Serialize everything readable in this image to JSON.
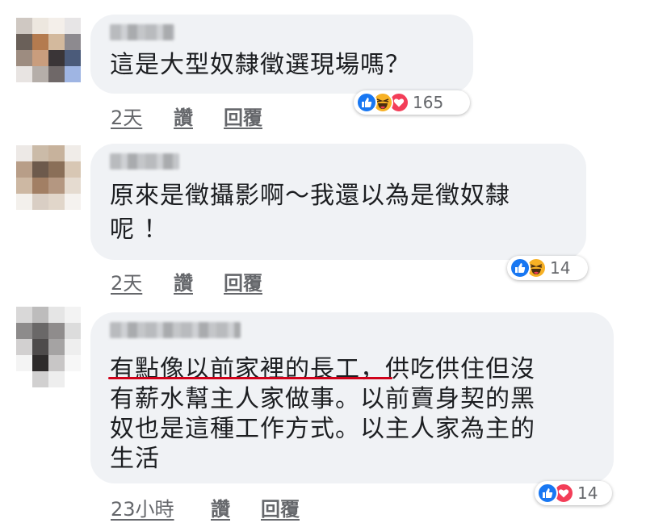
{
  "comments": [
    {
      "text_lines": [
        "這是大型奴隸徵選現場嗎？"
      ],
      "time": "2天",
      "like_label": "讚",
      "reply_label": "回覆",
      "reactions": [
        "like",
        "haha",
        "love"
      ],
      "reaction_count": "165"
    },
    {
      "text_lines": [
        "原來是徵攝影啊～我還以為是徵奴隸",
        "呢 ！"
      ],
      "time": "2天",
      "like_label": "讚",
      "reply_label": "回覆",
      "reactions": [
        "like",
        "haha"
      ],
      "reaction_count": "14"
    },
    {
      "text_lines": [
        "有點像以前家裡的長工，供吃供住但沒",
        "有薪水幫主人家做事。以前賣身契的黑",
        "奴也是這種工作方式。以主人家為主的",
        "生活"
      ],
      "time": "23小時",
      "like_label": "讚",
      "reply_label": "回覆",
      "reactions": [
        "like",
        "love"
      ],
      "reaction_count": "14"
    }
  ],
  "colors": {
    "bubble": "#f0f2f5",
    "meta_text": "#65676b",
    "like": "#1877f2",
    "haha": "#f7b125",
    "love": "#f33e58",
    "annotation_underline": "#d0021b"
  }
}
